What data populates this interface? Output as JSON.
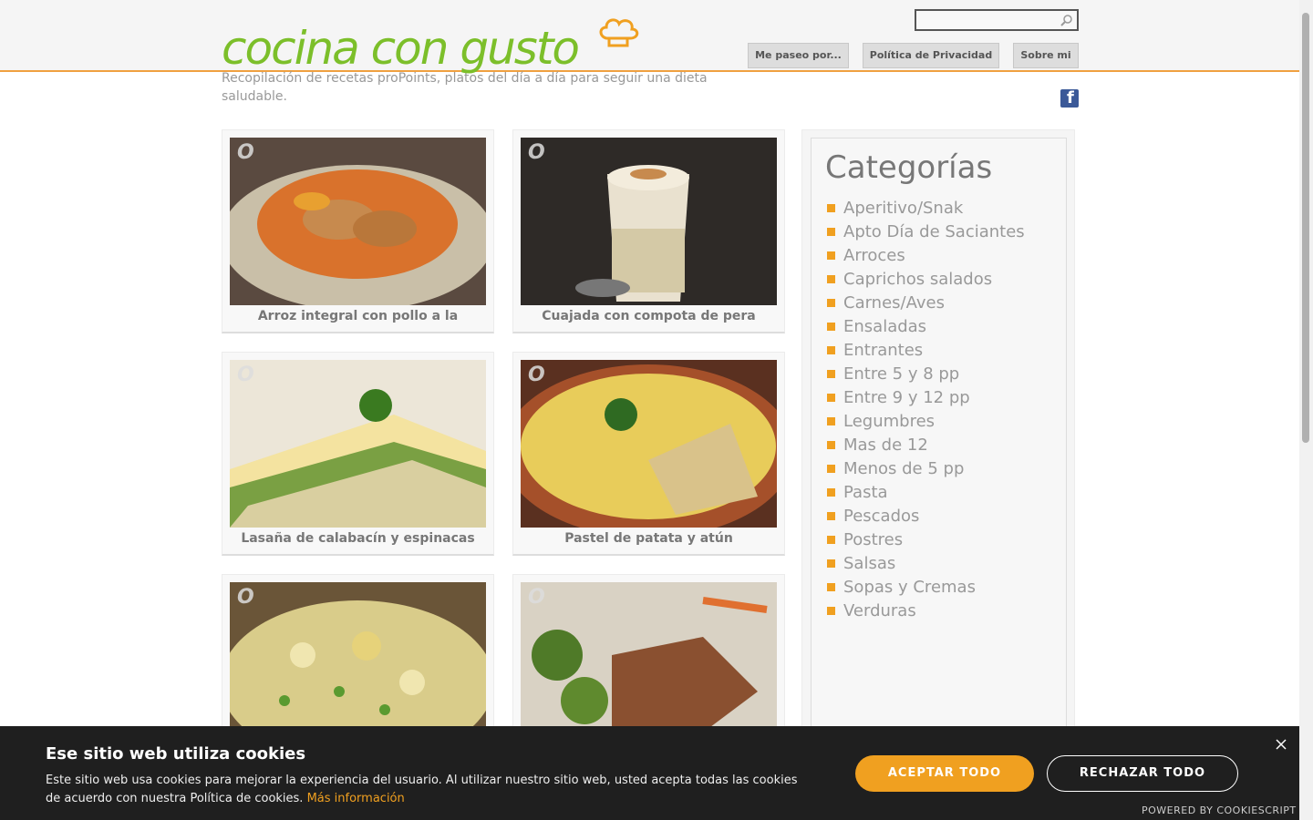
{
  "header": {
    "logo_text": "cocina con gusto",
    "tagline": "Recopilación de recetas proPoints, platos del día a día para seguir una dieta saludable.",
    "search_placeholder": "",
    "nav": [
      "Me paseo por...",
      "Política de Privacidad",
      "Sobre mi"
    ]
  },
  "social": {
    "facebook_icon": "facebook-icon"
  },
  "cards": [
    {
      "title": "Arroz integral con pollo a la"
    },
    {
      "title": "Cuajada con compota de pera"
    },
    {
      "title": "Lasaña de calabacín y espinacas"
    },
    {
      "title": "Pastel de patata y atún"
    },
    {
      "title": ""
    },
    {
      "title": ""
    }
  ],
  "sidebar": {
    "title": "Categorías",
    "items": [
      "Aperitivo/Snak",
      "Apto Día de Saciantes",
      "Arroces",
      "Caprichos salados",
      "Carnes/Aves",
      "Ensaladas",
      "Entrantes",
      "Entre 5 y 8 pp",
      "Entre 9 y 12 pp",
      "Legumbres",
      "Mas de 12",
      "Menos de 5 pp",
      "Pasta",
      "Pescados",
      "Postres",
      "Salsas",
      "Sopas y Cremas",
      "Verduras"
    ]
  },
  "cookie": {
    "title": "Ese sitio web utiliza cookies",
    "text": "Este sitio web usa cookies para mejorar la experiencia del usuario. Al utilizar nuestro sitio web, usted acepta todas las cookies de acuerdo con nuestra Política de cookies. ",
    "more_link": "Más información",
    "accept": "ACEPTAR TODO",
    "reject": "RECHAZAR TODO",
    "powered": "POWERED BY COOKIESCRIPT"
  },
  "colors": {
    "accent": "#f0a020",
    "logo_green": "#7cbf2a"
  }
}
